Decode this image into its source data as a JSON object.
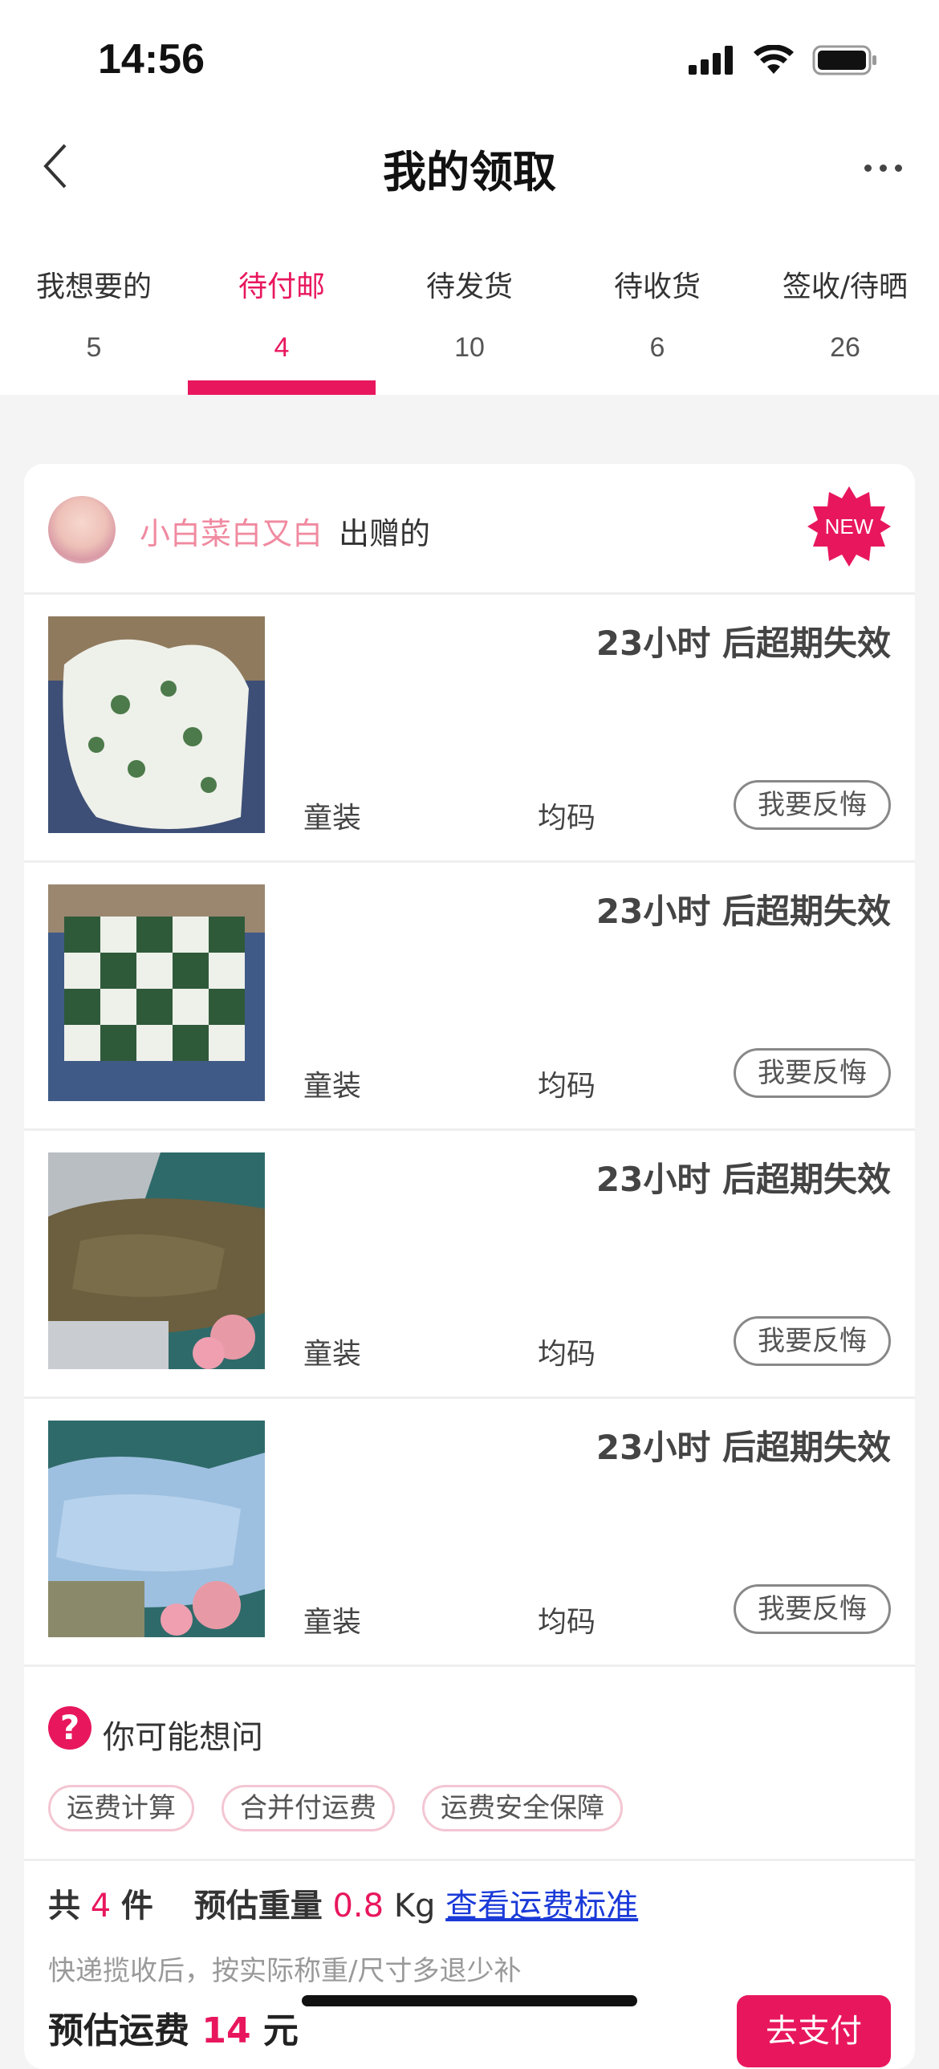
{
  "status_bar": {
    "time": "14:56"
  },
  "nav": {
    "title": "我的领取"
  },
  "tabs": [
    {
      "label": "我想要的",
      "count": "5"
    },
    {
      "label": "待付邮",
      "count": "4",
      "active": true
    },
    {
      "label": "待发货",
      "count": "10"
    },
    {
      "label": "待收货",
      "count": "6"
    },
    {
      "label": "签收/待晒",
      "count": "26"
    }
  ],
  "giver": {
    "name": "小白菜白又白",
    "suffix": "出赠的",
    "badge": "NEW"
  },
  "items": [
    {
      "expire": "23小时 后超期失效",
      "category": "童装",
      "size": "均码",
      "action": "我要反悔"
    },
    {
      "expire": "23小时 后超期失效",
      "category": "童装",
      "size": "均码",
      "action": "我要反悔"
    },
    {
      "expire": "23小时 后超期失效",
      "category": "童装",
      "size": "均码",
      "action": "我要反悔"
    },
    {
      "expire": "23小时 后超期失效",
      "category": "童装",
      "size": "均码",
      "action": "我要反悔"
    }
  ],
  "faq": {
    "title": "你可能想问",
    "chips": [
      "运费计算",
      "合并付运费",
      "运费安全保障"
    ]
  },
  "summary": {
    "total_prefix": "共",
    "total_count": "4",
    "total_unit": "件",
    "weight_label": "预估重量",
    "weight_value": "0.8",
    "weight_unit": "Kg",
    "standard_link": "查看运费标准",
    "note": "快递揽收后，按实际称重/尺寸多退少补",
    "freight_label": "预估运费",
    "freight_value": "14",
    "freight_unit": "元",
    "pay_button": "去支付"
  },
  "colors": {
    "accent": "#e8175d",
    "link": "#1a3ad8"
  }
}
